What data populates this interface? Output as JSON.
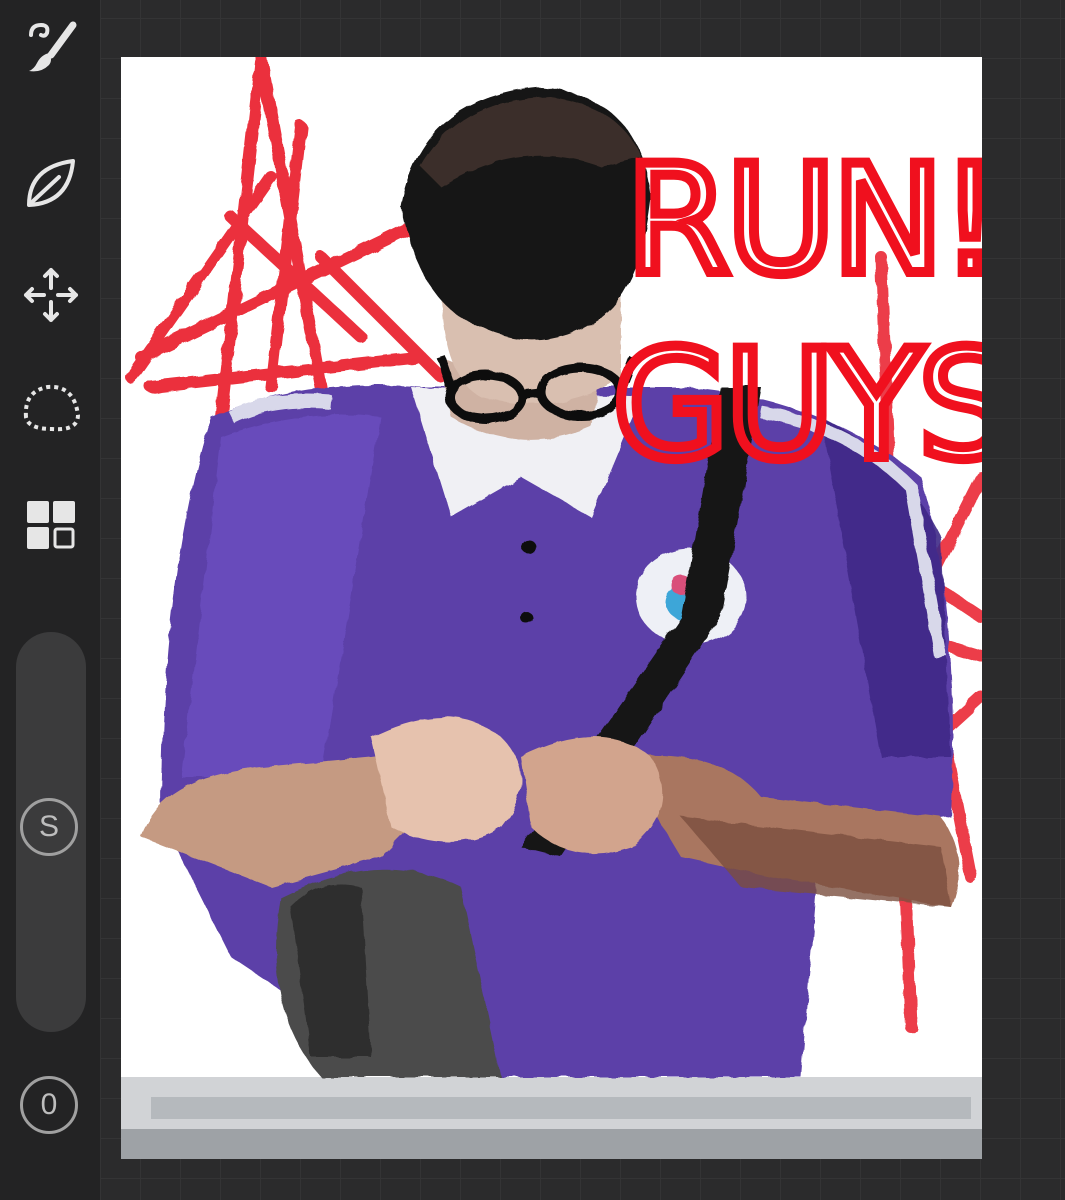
{
  "sidebar": {
    "tools": [
      {
        "name": "brush-tool",
        "icon": "brush-icon"
      },
      {
        "name": "leaf-tool",
        "icon": "leaf-icon"
      },
      {
        "name": "move-tool",
        "icon": "move-arrows-icon"
      },
      {
        "name": "lasso-tool",
        "icon": "lasso-icon"
      },
      {
        "name": "layers-tool",
        "icon": "layers-grid-icon"
      }
    ],
    "size_button_label": "S",
    "opacity_button_label": "0"
  },
  "canvas": {
    "painted_text_line1": "RUN!",
    "painted_text_line2": "GUYS"
  },
  "colors": {
    "sidebar_bg": "#232324",
    "workspace_bg": "#2b2b2c",
    "canvas_bg": "#ffffff",
    "paint_red": "#e8101e",
    "shirt_purple": "#5b3fa8"
  }
}
